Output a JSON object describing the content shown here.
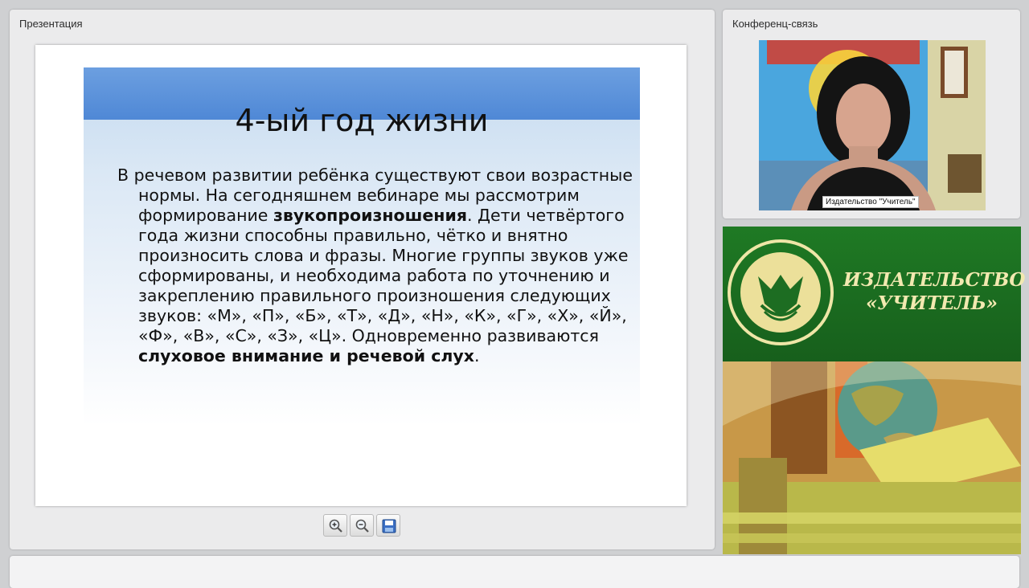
{
  "presentation": {
    "panel_title": "Презентация",
    "slide": {
      "title": "4-ый год жизни",
      "body_p1": "В речевом развитии ребёнка существуют свои возрастные нормы.  На сегодняшнем вебинаре мы рассмотрим формирование ",
      "body_b1": "звукопроизношения",
      "body_p2": ". Дети четвёртого года жизни способны правильно, чётко  и внятно произносить слова и фразы. Многие группы звуков уже сформированы, и необходима работа по уточнению и закреплению правильного произношения следующих звуков: «М», «П», «Б», «Т», «Д», «Н», «К», «Г», «Х», «Й», «Ф», «В», «С», «З», «Ц». Одновременно развиваются ",
      "body_b2": "слуховое внимание и речевой слух",
      "body_p3": "."
    },
    "toolbar": {
      "zoom_in_icon": "zoom-in-icon",
      "zoom_out_icon": "zoom-out-icon",
      "save_icon": "floppy-disk-icon"
    }
  },
  "conference": {
    "panel_title": "Конференц-связь",
    "participant_name": "Издательство \"Учитель\""
  },
  "branding": {
    "publisher_line1": "ИЗДАТЕЛЬСТВО",
    "publisher_line2": "«УЧИТЕЛЬ»"
  },
  "colors": {
    "slide_band": "#5b92db",
    "brand_green": "#1c6f21",
    "brand_cream": "#efe6a7"
  }
}
